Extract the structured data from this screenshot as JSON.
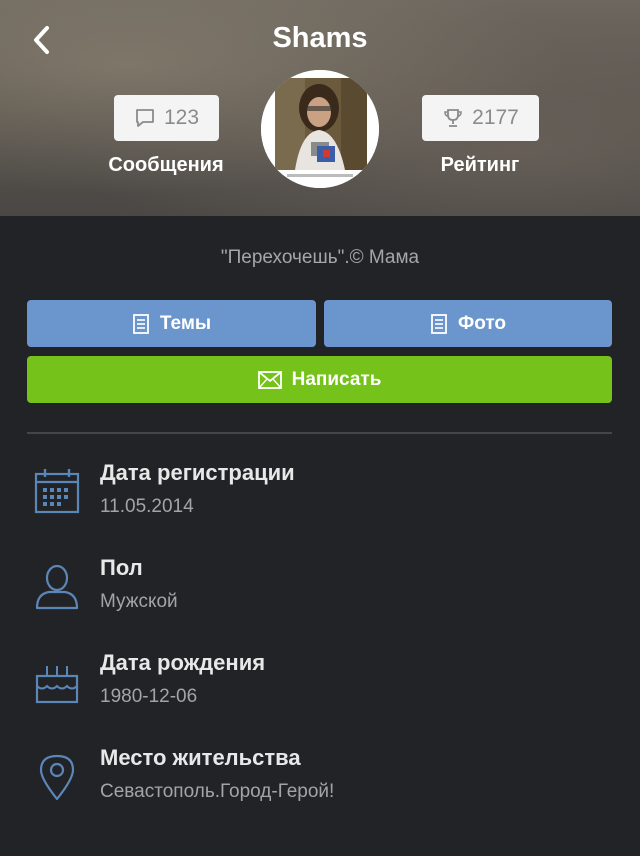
{
  "header": {
    "title": "Shams",
    "messages_count": "123",
    "messages_label": "Сообщения",
    "rating_value": "2177",
    "rating_label": "Рейтинг"
  },
  "profile": {
    "status_quote": "\"Перехочешь\".© Мама"
  },
  "buttons": {
    "topics_label": "Темы",
    "photos_label": "Фото",
    "write_label": "Написать"
  },
  "info": [
    {
      "title": "Дата регистрации",
      "value": "11.05.2014",
      "icon": "calendar-icon"
    },
    {
      "title": "Пол",
      "value": "Мужской",
      "icon": "user-icon"
    },
    {
      "title": "Дата рождения",
      "value": "1980-12-06",
      "icon": "cake-icon"
    },
    {
      "title": "Место жительства",
      "value": "Севастополь.Город-Герой!",
      "icon": "location-pin-icon"
    }
  ],
  "colors": {
    "background": "#222326",
    "button_blue": "#6b95cd",
    "button_green": "#74c21a",
    "icon_blue": "#5b86b8"
  }
}
